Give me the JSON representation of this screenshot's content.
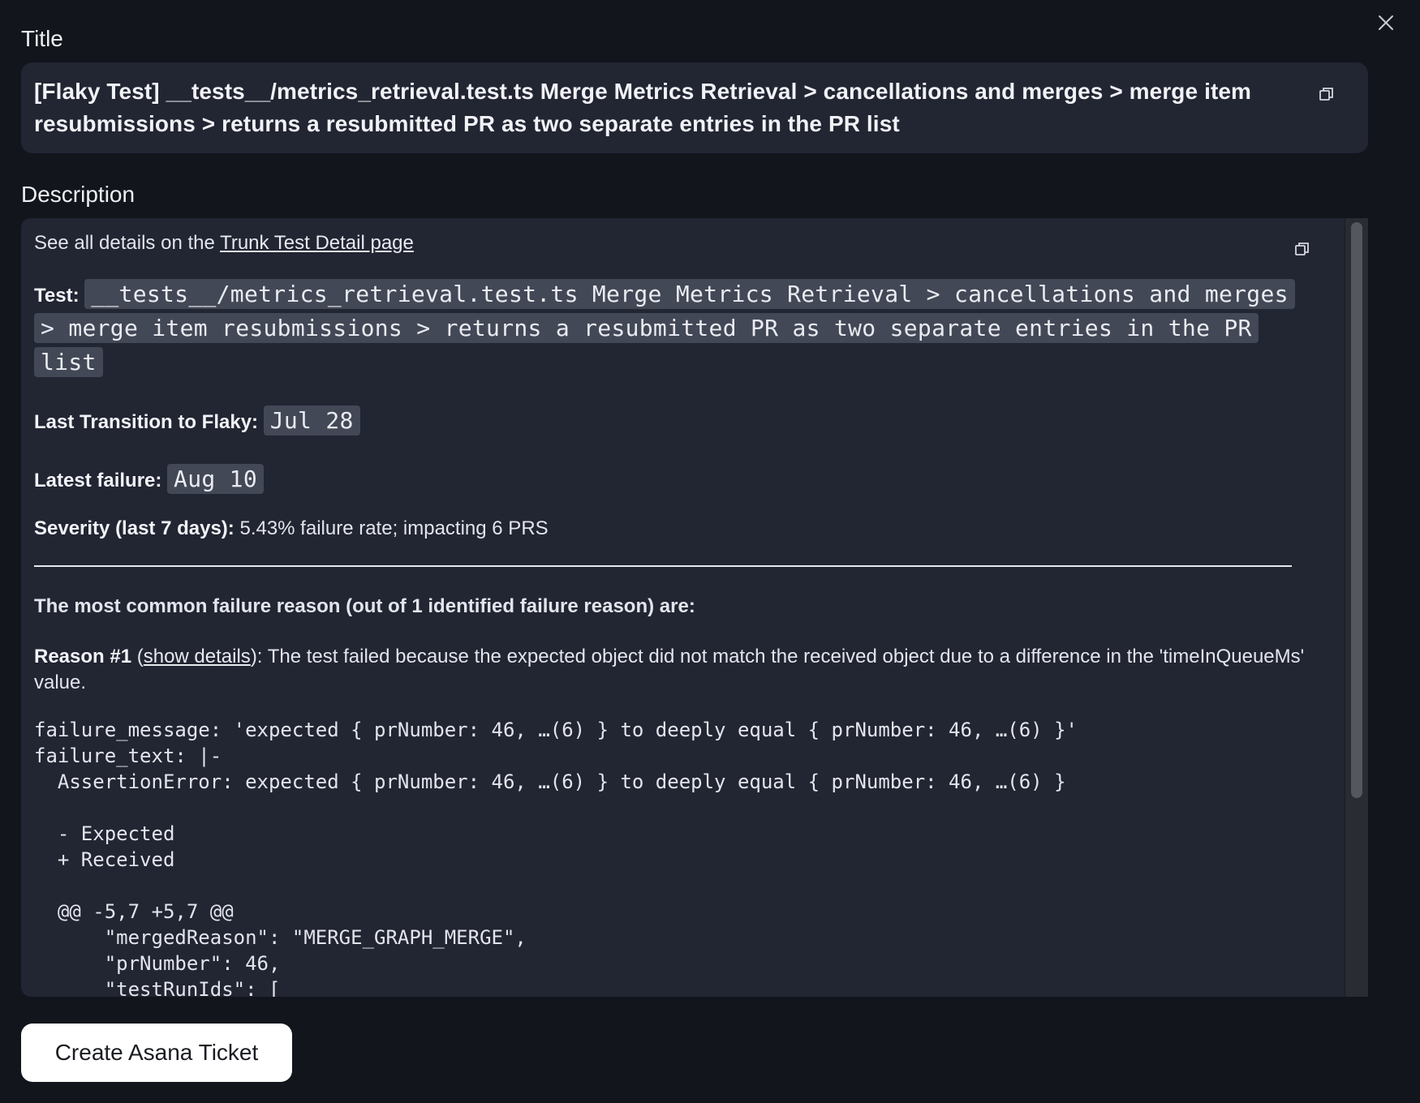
{
  "dialog": {
    "title_label": "Title",
    "title_value": "[Flaky Test] __tests__/metrics_retrieval.test.ts Merge Metrics Retrieval > cancellations and merges > merge item resubmissions > returns a resubmitted PR as two separate entries in the PR list",
    "description_label": "Description",
    "close_icon": "close-icon",
    "copy_icon": "copy-icon"
  },
  "description": {
    "details_prefix": "See all details on the ",
    "details_link": "Trunk Test Detail page",
    "test_label": "Test:",
    "test_value": "__tests__/metrics_retrieval.test.ts Merge Metrics Retrieval > cancellations and merges > merge item resubmissions > returns a resubmitted PR as two separate entries in the PR list",
    "last_transition_label": "Last Transition to Flaky:",
    "last_transition_value": "Jul 28",
    "latest_failure_label": "Latest failure:",
    "latest_failure_value": "Aug 10",
    "severity_label": "Severity (last 7 days):",
    "severity_value": " 5.43% failure rate; impacting 6 PRS",
    "common_reason_heading": "The  most common failure reason (out of 1 identified failure reason) are:",
    "reason_label": "Reason #1",
    "reason_paren_open": " (",
    "reason_link": "show details",
    "reason_paren_close": "):",
    "reason_text": " The test failed because the expected object did not match the received object due to a difference in the 'timeInQueueMs' value.",
    "code_block": "failure_message: 'expected { prNumber: 46, …(6) } to deeply equal { prNumber: 46, …(6) }'\nfailure_text: |-\n  AssertionError: expected { prNumber: 46, …(6) } to deeply equal { prNumber: 46, …(6) }\n\n  - Expected\n  + Received\n\n  @@ -5,7 +5,7 @@\n      \"mergedReason\": \"MERGE_GRAPH_MERGE\",\n      \"prNumber\": 46,\n      \"testRunIds\": ["
  },
  "actions": {
    "create_ticket_label": "Create Asana Ticket"
  }
}
